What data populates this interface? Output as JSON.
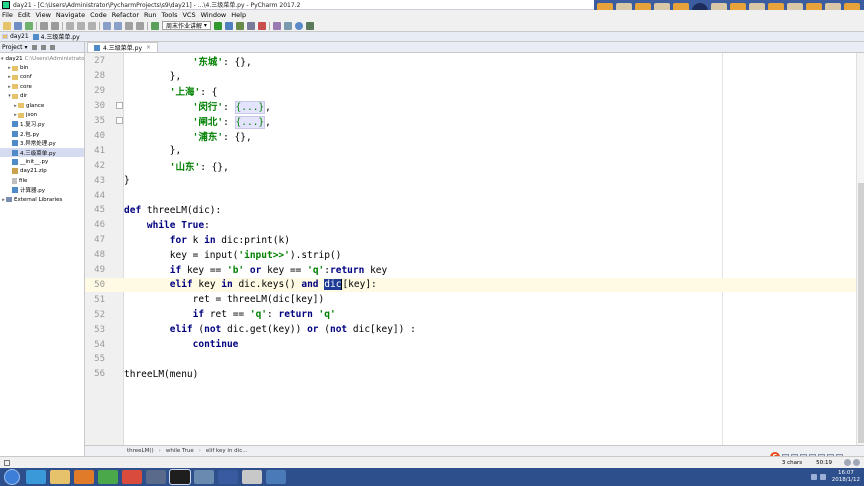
{
  "window": {
    "title": "day21 - [C:\\Users\\Administrator\\PycharmProjects\\s9\\day21] - ...\\4.三级菜单.py - PyCharm 2017.2"
  },
  "menu": [
    "File",
    "Edit",
    "View",
    "Navigate",
    "Code",
    "Refactor",
    "Run",
    "Tools",
    "VCS",
    "Window",
    "Help"
  ],
  "toolbar": {
    "run_config": "周末作业讲解"
  },
  "navbar": {
    "crumbs": [
      "day21",
      "4.三级菜单.py"
    ]
  },
  "project": {
    "header": "Project",
    "tree": [
      {
        "label": "day21",
        "hint": "C:\\Users\\Administrator",
        "icon": "folder",
        "depth": 0,
        "arrow": "▾"
      },
      {
        "label": "bin",
        "icon": "folder",
        "depth": 1,
        "arrow": "▸"
      },
      {
        "label": "conf",
        "icon": "folder",
        "depth": 1,
        "arrow": "▸"
      },
      {
        "label": "core",
        "icon": "folder",
        "depth": 1,
        "arrow": "▸"
      },
      {
        "label": "dir",
        "icon": "folder",
        "depth": 1,
        "arrow": "▾"
      },
      {
        "label": "glance",
        "icon": "folder",
        "depth": 2,
        "arrow": "▸"
      },
      {
        "label": "json",
        "icon": "folder",
        "depth": 2,
        "arrow": "▸"
      },
      {
        "label": "1.复习.py",
        "icon": "py",
        "depth": 1,
        "arrow": ""
      },
      {
        "label": "2.包.py",
        "icon": "py",
        "depth": 1,
        "arrow": ""
      },
      {
        "label": "3.异常处理.py",
        "icon": "py",
        "depth": 1,
        "arrow": ""
      },
      {
        "label": "4.三级菜单.py",
        "icon": "py",
        "depth": 1,
        "arrow": "",
        "selected": true
      },
      {
        "label": "__init__.py",
        "icon": "py",
        "depth": 1,
        "arrow": ""
      },
      {
        "label": "day21.zip",
        "icon": "zip",
        "depth": 1,
        "arrow": ""
      },
      {
        "label": "file",
        "icon": "file",
        "depth": 1,
        "arrow": ""
      },
      {
        "label": "计算器.py",
        "icon": "py",
        "depth": 1,
        "arrow": ""
      },
      {
        "label": "External Libraries",
        "icon": "lib",
        "depth": 0,
        "arrow": "▸"
      }
    ]
  },
  "editor": {
    "tab": "4.三级菜单.py",
    "tab_close": "×",
    "current_line": "50",
    "lines": [
      {
        "num": "27",
        "fold": false,
        "html": "            <span class=\"str\">'东城'</span>: {},"
      },
      {
        "num": "28",
        "fold": false,
        "html": "        },"
      },
      {
        "num": "29",
        "fold": false,
        "html": "        <span class=\"str\">'上海'</span>: {"
      },
      {
        "num": "30",
        "fold": true,
        "html": "            <span class=\"str\">'闵行'</span>: <span class=\"fold\">{...}</span>,"
      },
      {
        "num": "35",
        "fold": true,
        "html": "            <span class=\"str\">'闸北'</span>: <span class=\"fold\">{...}</span>,"
      },
      {
        "num": "40",
        "fold": false,
        "html": "            <span class=\"str\">'浦东'</span>: {},"
      },
      {
        "num": "41",
        "fold": false,
        "html": "        },"
      },
      {
        "num": "42",
        "fold": false,
        "html": "        <span class=\"str\">'山东'</span>: {},"
      },
      {
        "num": "43",
        "fold": false,
        "html": "}"
      },
      {
        "num": "44",
        "fold": false,
        "html": ""
      },
      {
        "num": "45",
        "fold": false,
        "html": "<span class=\"kw\">def</span> threeLM(dic):"
      },
      {
        "num": "46",
        "fold": false,
        "html": "    <span class=\"kw\">while</span> <span class=\"kw\">True</span>:"
      },
      {
        "num": "47",
        "fold": false,
        "html": "        <span class=\"kw\">for</span> k <span class=\"kw\">in</span> dic:print(k)"
      },
      {
        "num": "48",
        "fold": false,
        "html": "        key = input(<span class=\"str\">'input&gt;&gt;'</span>).strip()"
      },
      {
        "num": "49",
        "fold": false,
        "html": "        <span class=\"kw\">if</span> key == <span class=\"str\">'b'</span> <span class=\"kw\">or</span> key == <span class=\"str\">'q'</span>:<span class=\"kw\">return</span> key"
      },
      {
        "num": "50",
        "fold": false,
        "html": "        <span class=\"kw\">elif</span> key <span class=\"kw\">in</span> dic.keys() <span class=\"kw\">and</span> <span class=\"hl\">dic</span><span class=\"cursor\">[</span>key]:"
      },
      {
        "num": "51",
        "fold": false,
        "html": "            ret = threeLM(dic[key])"
      },
      {
        "num": "52",
        "fold": false,
        "html": "            <span class=\"kw\">if</span> ret == <span class=\"str\">'q'</span>: <span class=\"kw\">return</span> <span class=\"str\">'q'</span>"
      },
      {
        "num": "53",
        "fold": false,
        "html": "        <span class=\"kw\">elif</span> (<span class=\"kw\">not</span> dic.get(key)) <span class=\"kw\">or</span> (<span class=\"kw\">not</span> dic[key]) :"
      },
      {
        "num": "54",
        "fold": false,
        "html": "            <span class=\"kw\">continue</span>"
      },
      {
        "num": "55",
        "fold": false,
        "html": ""
      },
      {
        "num": "56",
        "fold": false,
        "html": "threeLM(menu)"
      }
    ]
  },
  "bottom_breadcrumb": [
    "threeLM()",
    "while True",
    "elif key in dic..."
  ],
  "status": {
    "chars": "3 chars",
    "position": "50:19"
  },
  "taskbar": {
    "time": "16:07",
    "date": "2018/1/12"
  },
  "colors": {
    "keyword": "#000080",
    "string": "#008000",
    "selection": "#1e3c96",
    "current_line": "#fffae3",
    "taskbar": "#2d4f8c"
  }
}
